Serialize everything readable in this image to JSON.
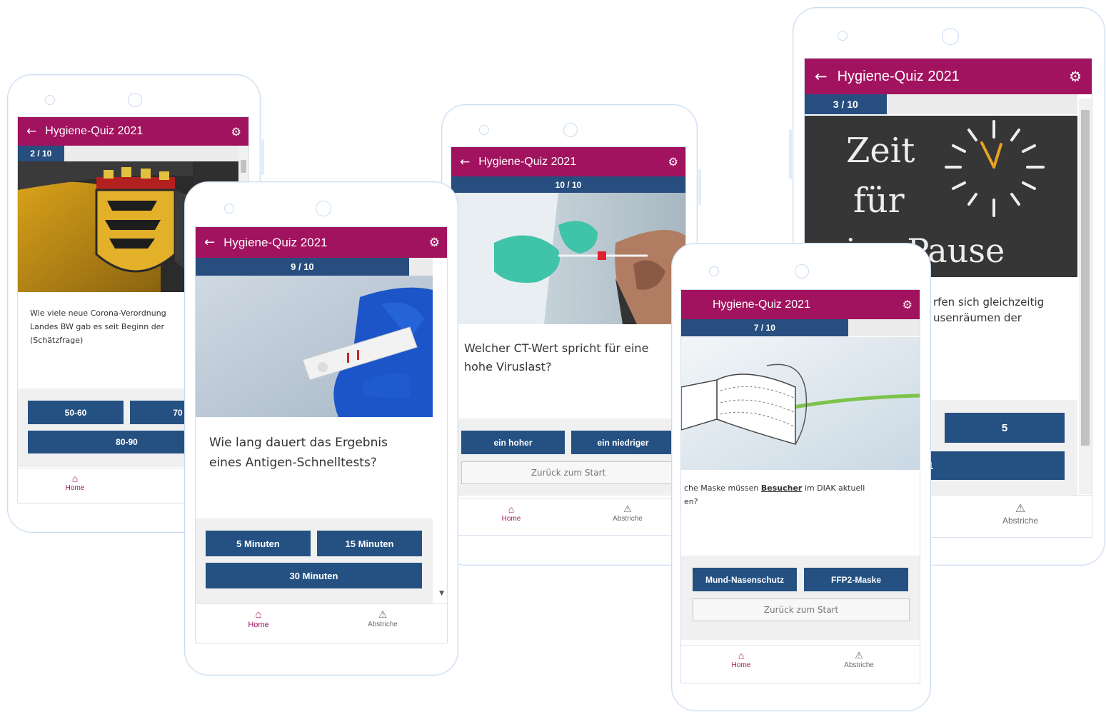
{
  "app": {
    "title": "Hygiene-Quiz 2021",
    "brand_color": "#a2135f",
    "primary_color": "#245182",
    "back_icon": "arrow-left-icon",
    "settings_icon": "gear-icon"
  },
  "nav": {
    "home_label": "Home",
    "abstriche_label": "Abstriche",
    "home_icon": "home-icon",
    "abstriche_icon": "warning-triangle-icon"
  },
  "back_to_start": "Zurück zum Start",
  "screens": {
    "s1": {
      "progress": "2 / 10",
      "progress_fraction": 0.2,
      "question": "Wie viele neue Corona-Verordnung Landes BW gab es seit Beginn der (Schätzfrage)",
      "answers": [
        "50-60",
        "70",
        "80-90"
      ]
    },
    "s2": {
      "progress": "9 / 10",
      "progress_fraction": 0.9,
      "question": "Wie lang dauert das Ergebnis eines Antigen-Schnelltests?",
      "answers": [
        "5 Minuten",
        "15 Minuten",
        "30 Minuten"
      ]
    },
    "s3": {
      "progress": "10 / 10",
      "progress_fraction": 1.0,
      "question": "Welcher CT-Wert spricht für eine hohe Viruslast?",
      "answers": [
        "ein hoher",
        "ein niedriger"
      ]
    },
    "s4": {
      "progress": "7 / 10",
      "progress_fraction": 0.7,
      "question_pre": "che Maske müssen ",
      "question_emph": "Besucher",
      "question_post": " im DIAK aktuell",
      "question_line2": "en?",
      "answers": [
        "Mund-Nasenschutz",
        "FFP2-Maske"
      ]
    },
    "s5": {
      "progress": "3 / 10",
      "progress_fraction": 0.3,
      "image_text_1": "Zeit",
      "image_text_2": "für",
      "image_text_3": "eine Pause",
      "question_line1": "rfen sich gleichzeitig",
      "question_line2": "usenräumen der",
      "answers": [
        "5",
        "1"
      ]
    }
  }
}
